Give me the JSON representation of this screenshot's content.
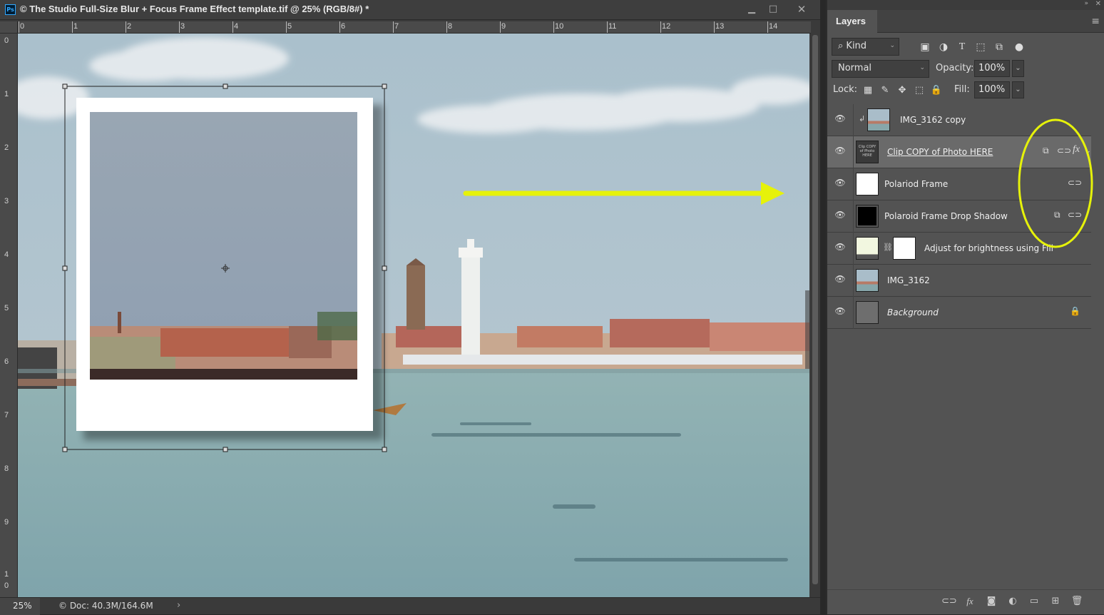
{
  "document": {
    "title": "© The Studio Full-Size Blur + Focus Frame Effect template.tif @ 25% (RGB/8#) *",
    "window_controls": [
      "minimize",
      "maximize",
      "close"
    ],
    "ruler_top": [
      "0",
      "1",
      "2",
      "3",
      "4",
      "5",
      "6",
      "7",
      "8",
      "9",
      "10",
      "11",
      "12",
      "13",
      "14"
    ],
    "ruler_left": [
      "0",
      "1",
      "2",
      "3",
      "4",
      "5",
      "6",
      "7",
      "8",
      "9",
      "1",
      "0"
    ],
    "zoom": "25%",
    "doc_info": "© Doc: 40.3M/164.6M",
    "status_arrow": "›"
  },
  "panel": {
    "tab": "Layers",
    "filter_kind": "Kind",
    "blend_mode": "Normal",
    "opacity_label": "Opacity:",
    "opacity_value": "100%",
    "lock_label": "Lock:",
    "fill_label": "Fill:",
    "fill_value": "100%",
    "layers": [
      {
        "name": "IMG_3162 copy",
        "thumb": "photo",
        "clipped": true
      },
      {
        "name": "Clip COPY of Photo HERE",
        "thumb": "dark-text",
        "selected": true,
        "badges": [
          "smart-object-icon",
          "link-icon",
          "fx-icon"
        ]
      },
      {
        "name": "Polariod Frame",
        "thumb": "white",
        "badges": [
          "link-icon"
        ]
      },
      {
        "name": "Polaroid Frame Drop Shadow",
        "thumb": "black",
        "badges": [
          "smart-object-icon",
          "link-icon"
        ]
      },
      {
        "name": "Adjust for brightness using Fill",
        "thumb": "fill",
        "mask": true
      },
      {
        "name": "IMG_3162",
        "thumb": "photo"
      },
      {
        "name": "Background",
        "thumb": "gray",
        "italic": true,
        "locked": true
      }
    ]
  },
  "annotations": {
    "arrow_color": "#e6f20a",
    "ellipse_color": "#e6f20a"
  }
}
